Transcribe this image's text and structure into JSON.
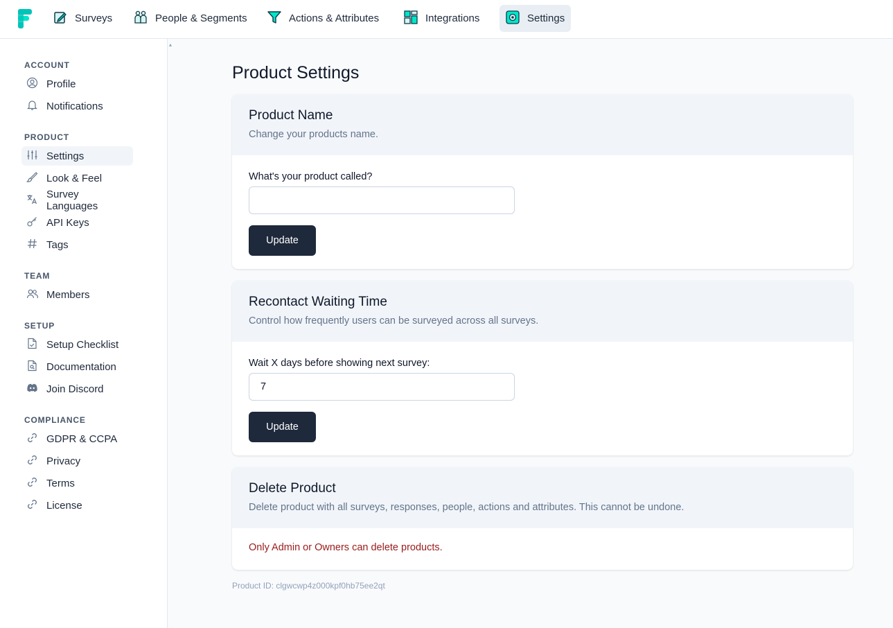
{
  "colors": {
    "brand": "#00c4b8",
    "primary_button": "#1e293b",
    "danger_text": "#991b1b",
    "card_header_bg": "#f1f5f9"
  },
  "topnav": {
    "logo_icon": "formbricks-logo-icon",
    "items": [
      {
        "label": "Surveys",
        "icon": "survey-edit-icon",
        "active": false
      },
      {
        "label": "People & Segments",
        "icon": "people-icon",
        "active": false
      },
      {
        "label": "Actions & Attributes",
        "icon": "funnel-icon",
        "active": false
      },
      {
        "label": "Integrations",
        "icon": "integrations-grid-icon",
        "active": false
      },
      {
        "label": "Settings",
        "icon": "settings-gear-icon",
        "active": true
      }
    ]
  },
  "sidebar": {
    "sections": [
      {
        "heading": "ACCOUNT",
        "items": [
          {
            "label": "Profile",
            "icon": "user-circle-icon"
          },
          {
            "label": "Notifications",
            "icon": "bell-icon"
          }
        ]
      },
      {
        "heading": "PRODUCT",
        "items": [
          {
            "label": "Settings",
            "icon": "sliders-icon",
            "active": true
          },
          {
            "label": "Look & Feel",
            "icon": "brush-icon"
          },
          {
            "label": "Survey Languages",
            "icon": "language-icon"
          },
          {
            "label": "API Keys",
            "icon": "key-icon"
          },
          {
            "label": "Tags",
            "icon": "hash-icon"
          }
        ]
      },
      {
        "heading": "TEAM",
        "items": [
          {
            "label": "Members",
            "icon": "users-icon"
          }
        ]
      },
      {
        "heading": "SETUP",
        "items": [
          {
            "label": "Setup Checklist",
            "icon": "checklist-doc-icon"
          },
          {
            "label": "Documentation",
            "icon": "doc-search-icon"
          },
          {
            "label": "Join Discord",
            "icon": "discord-icon"
          }
        ]
      },
      {
        "heading": "COMPLIANCE",
        "items": [
          {
            "label": "GDPR & CCPA",
            "icon": "link-icon"
          },
          {
            "label": "Privacy",
            "icon": "link-icon"
          },
          {
            "label": "Terms",
            "icon": "link-icon"
          },
          {
            "label": "License",
            "icon": "link-icon"
          }
        ]
      }
    ]
  },
  "main": {
    "title": "Product Settings",
    "product_name": {
      "title": "Product Name",
      "description": "Change your products name.",
      "field_label": "What's your product called?",
      "field_value": "",
      "button": "Update"
    },
    "recontact": {
      "title": "Recontact Waiting Time",
      "description": "Control how frequently users can be surveyed across all surveys.",
      "field_label": "Wait X days before showing next survey:",
      "field_value": "7",
      "button": "Update"
    },
    "delete_product": {
      "title": "Delete Product",
      "description": "Delete product with all surveys, responses, people, actions and attributes. This cannot be undone.",
      "warning": "Only Admin or Owners can delete products."
    },
    "product_id": "Product ID: clgwcwp4z000kpf0hb75ee2qt"
  }
}
